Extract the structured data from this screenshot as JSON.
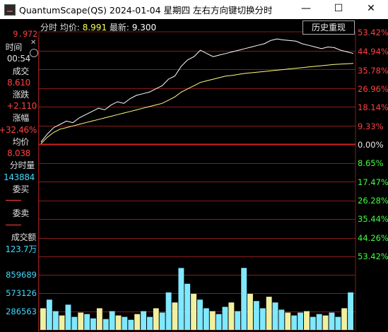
{
  "window": {
    "title": "QuantumScape(QS) 2024-01-04 星期四    左右方向键切换分时",
    "min_label": "—",
    "max_label": "☐",
    "close_label": "✕"
  },
  "header": {
    "label_prefix": "分时",
    "avg_label": "均价:",
    "avg_value": "8.991",
    "latest_label": "最新:",
    "latest_value": "9.300",
    "history_button": "历史重现"
  },
  "left_panel": {
    "top_price": "9.972",
    "time_label": "时间",
    "time_value": "00:54",
    "trade_label": "成交",
    "trade_value": "8.610",
    "change_label": "涨跌",
    "change_value": "+2.110",
    "pct_label": "涨幅",
    "pct_value": "+32.46%",
    "avg_label": "均价",
    "avg_value": "8.038",
    "minute_vol_label": "分时量",
    "minute_vol_value": "143884",
    "bid_label": "委买",
    "ask_label": "委卖",
    "amount_label": "成交额",
    "amount_value": "123.7万"
  },
  "right_axis": {
    "up": [
      "53.42%",
      "44.94%",
      "35.78%",
      "26.96%",
      "18.14%",
      "9.33%"
    ],
    "zero": "0.00%",
    "down": [
      "8.65%",
      "17.47%",
      "26.28%",
      "35.44%",
      "44.26%",
      "53.42%"
    ]
  },
  "volume_axis": [
    "859689",
    "573126",
    "286563"
  ],
  "colors": {
    "up": "#ff4040",
    "down": "#40ff40",
    "price_line": "#ffffff",
    "avg_line": "#ffff80",
    "grid": "#8a1a1a",
    "volume": "#80e8ff"
  },
  "chart_data": {
    "type": "line",
    "series": [
      {
        "name": "最新",
        "values": [
          6.55,
          6.8,
          7.0,
          7.1,
          7.2,
          7.15,
          7.3,
          7.4,
          7.5,
          7.6,
          7.55,
          7.7,
          7.8,
          7.75,
          7.9,
          8.0,
          8.05,
          8.1,
          8.2,
          8.3,
          8.5,
          8.6,
          8.9,
          9.1,
          9.2,
          9.4,
          9.3,
          9.2,
          9.25,
          9.3,
          9.35,
          9.4,
          9.45,
          9.5,
          9.55,
          9.6,
          9.7,
          9.75,
          9.72,
          9.7,
          9.68,
          9.6,
          9.55,
          9.5,
          9.45,
          9.5,
          9.48,
          9.4,
          9.35,
          9.3
        ]
      },
      {
        "name": "均价",
        "values": [
          6.5,
          6.7,
          6.85,
          6.95,
          7.0,
          7.05,
          7.1,
          7.15,
          7.2,
          7.25,
          7.3,
          7.35,
          7.4,
          7.45,
          7.5,
          7.55,
          7.6,
          7.65,
          7.7,
          7.75,
          7.85,
          7.95,
          8.1,
          8.2,
          8.3,
          8.4,
          8.45,
          8.5,
          8.55,
          8.6,
          8.62,
          8.65,
          8.68,
          8.7,
          8.72,
          8.74,
          8.76,
          8.78,
          8.8,
          8.82,
          8.84,
          8.86,
          8.88,
          8.9,
          8.92,
          8.94,
          8.96,
          8.97,
          8.98,
          8.99
        ]
      }
    ],
    "volume": [
      300000,
      420000,
      260000,
      200000,
      350000,
      180000,
      240000,
      220000,
      160000,
      300000,
      150000,
      260000,
      200000,
      180000,
      140000,
      220000,
      260000,
      180000,
      300000,
      240000,
      520000,
      380000,
      859000,
      640000,
      500000,
      420000,
      300000,
      260000,
      220000,
      320000,
      380000,
      260000,
      860000,
      500000,
      400000,
      300000,
      460000,
      380000,
      280000,
      240000,
      200000,
      240000,
      260000,
      180000,
      220000,
      200000,
      240000,
      180000,
      300000,
      520000
    ],
    "yref": 6.5,
    "yrange": [
      3.0,
      9.972
    ],
    "volmax": 1000000
  }
}
